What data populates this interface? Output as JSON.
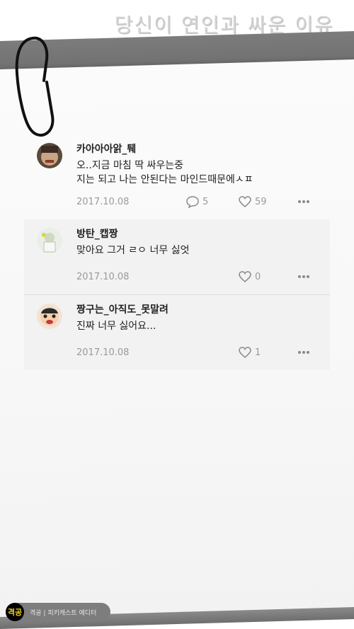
{
  "header": {
    "title": "당신이 연인과 싸운 이유"
  },
  "comments": [
    {
      "username": "카아아아앍_퉤",
      "line1": "오..지금 마침 딱 싸우는중",
      "line2": "지는 되고 나는 안된다는 마인드때문에ㅅㅍ",
      "date": "2017.10.08",
      "reply_count": "5",
      "like_count": "59"
    }
  ],
  "replies": [
    {
      "username": "방탄_캡짱",
      "text": "맞아요 그거 ㄹㅇ 너무 싫엇",
      "date": "2017.10.08",
      "like_count": "0"
    },
    {
      "username": "짱구는_아직도_못말려",
      "text": "진짜 너무 싫어요...",
      "date": "2017.10.08",
      "like_count": "1"
    }
  ],
  "footer": {
    "logo": "격공",
    "text": "격공 | 피키캐스트 에디터"
  },
  "icons": {
    "reply": "speech-bubble-icon",
    "like": "heart-icon",
    "more": "more-dots-icon",
    "clip": "paperclip-icon"
  }
}
